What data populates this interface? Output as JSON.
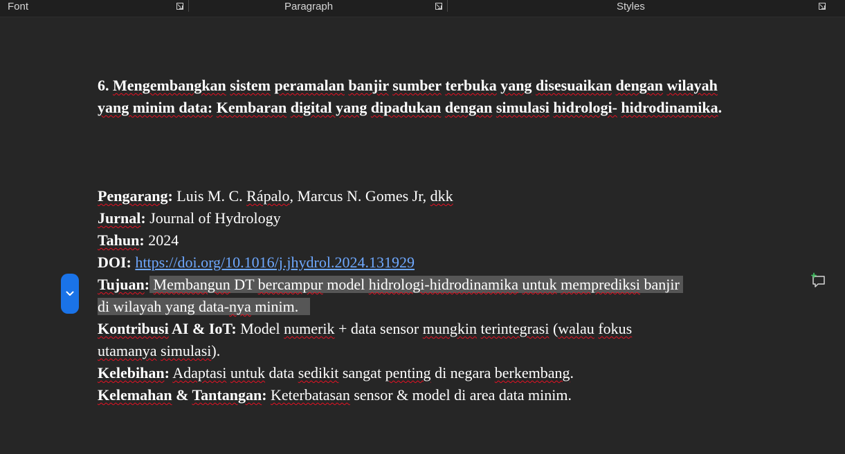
{
  "ribbon": {
    "font_label": "Font",
    "paragraph_label": "Paragraph",
    "styles_label": "Styles"
  },
  "document": {
    "heading": {
      "number": "6.",
      "w1": "Mengembangkan",
      "w2": "sistem",
      "w3": "peramalan",
      "w4": "banjir",
      "w5": "sumber",
      "w6": "terbuka",
      "w7": "yang",
      "w8": "disesuaikan",
      "w9": "dengan",
      "w10": "wilayah yang minim data:",
      "w11": "Kembaran",
      "w12": "digital yang",
      "w13": "dipadukan",
      "w14": "dengan",
      "w15": "simulasi",
      "w16": "hidrologi-",
      "w17": "hidrodinamika",
      "w18": "."
    },
    "authors": {
      "label": "Pengarang",
      "colon": ":",
      "v1": " Luis M. C. ",
      "v2": "Rápalo",
      "v3": ", Marcus N. Gomes Jr, ",
      "v4": "dkk"
    },
    "journal": {
      "label": "Jurnal",
      "colon": ":",
      "value": " Journal of Hydrology"
    },
    "year": {
      "label": "Tahun",
      "colon": ":",
      "value": " 2024"
    },
    "doi": {
      "label": "DOI:",
      "space": " ",
      "url": "https://doi.org/10.1016/j.jhydrol.2024.131929"
    },
    "goal": {
      "label": "Tujuan",
      "colon": ":",
      "t1": " ",
      "t2": "Membangun",
      "t3": " DT ",
      "t4": "bercampur",
      "t5": " model ",
      "t6": "hidrologi-hidrodinamika",
      "t7": " ",
      "t8": "untuk",
      "t9": " ",
      "t10": "memprediksi",
      "t11": " ",
      "t12": "banjir",
      "t13": "di ",
      "t14": "wilayah",
      "t15": " ",
      "t16": "yang",
      "t17": " data-",
      "t18": "nya",
      "t19": " minim."
    },
    "contribution": {
      "label1": "Kontribusi",
      "label2": " AI & IoT:",
      "t1": " Model ",
      "t2": "numerik",
      "t3": " + data sensor ",
      "t4": "mungkin",
      "t5": " ",
      "t6": "terintegrasi",
      "t7": " (",
      "t8": "walau",
      "t9": " ",
      "t10": "fokus",
      "t11": "utamanya",
      "t12": " ",
      "t13": "simulasi",
      "t14": ")."
    },
    "advantage": {
      "label": "Kelebihan",
      "colon": ":",
      "t1": " ",
      "t2": "Adaptasi",
      "t3": " ",
      "t4": "untuk",
      "t5": " data ",
      "t6": "sedikit",
      "t7": " sangat ",
      "t8": "penting",
      "t9": " di negara ",
      "t10": "berkembang",
      "t11": "."
    },
    "weakness": {
      "label1": "Kelemahan",
      "label2": " & ",
      "label3": "Tantangan",
      "colon": ":",
      "t1": " ",
      "t2": "Keterbatasan",
      "t3": " sensor & model di area data minim."
    }
  },
  "icons": {
    "scroll_handle": "chevron-down-icon",
    "comment": "new-comment-icon"
  },
  "colors": {
    "page_background": "#262626",
    "ribbon_background": "#1f1f1f",
    "text": "#ffffff",
    "link": "#6ea8ff",
    "selection": "#565656",
    "spell_squiggle": "#e81123",
    "scroll_handle": "#1a73e8",
    "comment_icon": "#3fbf5f"
  }
}
